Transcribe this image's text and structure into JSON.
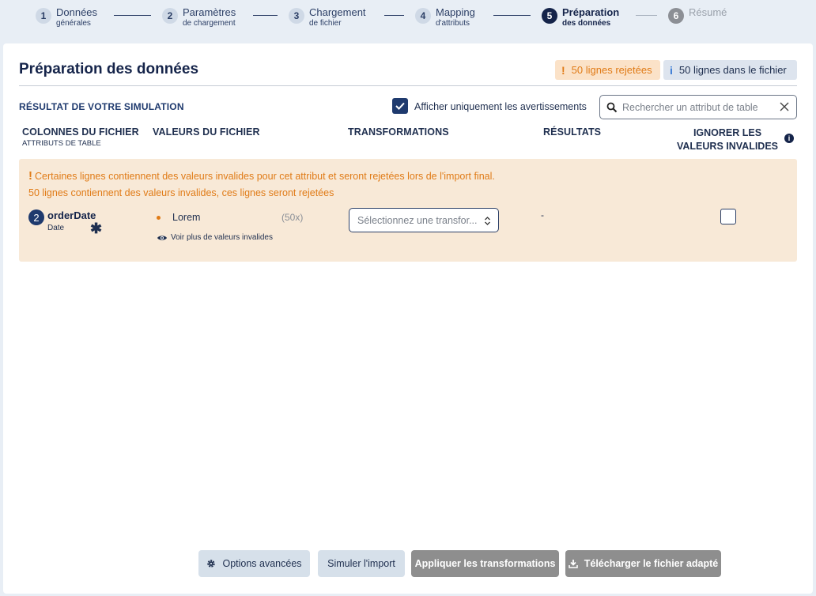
{
  "stepper": {
    "steps": [
      {
        "num": "1",
        "title": "Données",
        "subtitle": "générales",
        "state": "done"
      },
      {
        "num": "2",
        "title": "Paramètres",
        "subtitle": "de chargement",
        "state": "done"
      },
      {
        "num": "3",
        "title": "Chargement",
        "subtitle": "de fichier",
        "state": "done"
      },
      {
        "num": "4",
        "title": "Mapping",
        "subtitle": "d'attributs",
        "state": "done"
      },
      {
        "num": "5",
        "title": "Préparation",
        "subtitle": "des données",
        "state": "active"
      },
      {
        "num": "6",
        "title": "Résumé",
        "subtitle": "",
        "state": "disabled"
      }
    ]
  },
  "page": {
    "title": "Préparation des données",
    "badge_rejected": "50 lignes rejetées",
    "badge_total": "50 lignes dans le fichier"
  },
  "toolbar": {
    "section_title": "RÉSULTAT DE VOTRE SIMULATION",
    "warnings_only_label": "Afficher uniquement les avertissements",
    "warnings_only_checked": true,
    "search_placeholder": "Rechercher un attribut de table"
  },
  "columns": {
    "file_columns": "COLONNES DU FICHIER",
    "table_attributes": "ATTRIBUTS DE TABLE",
    "file_values": "VALEURS DU FICHIER",
    "transformations": "TRANSFORMATIONS",
    "results": "RÉSULTATS",
    "ignore_invalid_line1": "IGNORER LES",
    "ignore_invalid_line2": "VALEURS INVALIDES"
  },
  "row": {
    "warning_main": "Certaines lignes contiennent des valeurs invalides pour cet attribut et seront rejetées lors de l'import final.",
    "warning_detail": "50 lignes contiennent des valeurs invalides, ces lignes seront rejetées",
    "attr_index": "2",
    "attr_name": "orderDate",
    "attr_type": "Date",
    "value": "Lorem",
    "value_count": "(50x)",
    "more_values_link": "Voir plus de valeurs invalides",
    "transform_placeholder": "Sélectionnez une transfor...",
    "result": "-",
    "ignore_checked": false
  },
  "footer": {
    "advanced_options": "Options avancées",
    "simulate": "Simuler l'import",
    "apply": "Appliquer les transformations",
    "download": "Télécharger le fichier adapté"
  },
  "colors": {
    "primary": "#15244a",
    "warning": "#e07b17",
    "warning_bg": "#f8e9d7"
  }
}
